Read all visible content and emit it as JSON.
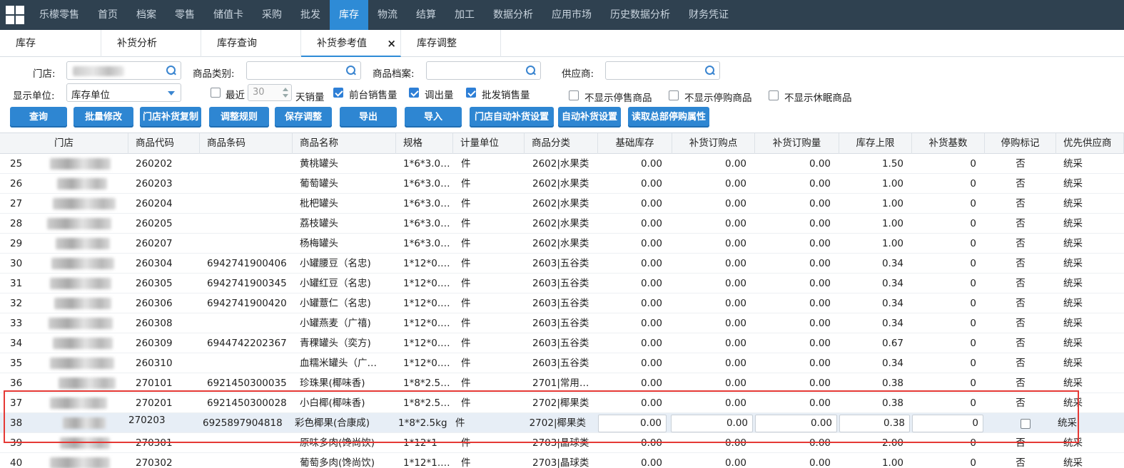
{
  "nav": {
    "items": [
      "乐檬零售",
      "首页",
      "档案",
      "零售",
      "储值卡",
      "采购",
      "批发",
      "库存",
      "物流",
      "结算",
      "加工",
      "数据分析",
      "应用市场",
      "历史数据分析",
      "财务凭证"
    ],
    "active_index": 7
  },
  "tabs": {
    "items": [
      "库存",
      "补货分析",
      "库存查询",
      "补货参考值",
      "库存调整"
    ],
    "active_index": 3,
    "close_glyph": "×"
  },
  "filters": {
    "store_label": "门店:",
    "category_label": "商品类别:",
    "archive_label": "商品档案:",
    "supplier_label": "供应商:",
    "unit_label": "显示单位:",
    "unit_value": "库存单位",
    "recent_label": "最近",
    "recent_days": "30",
    "days_label": "天销量",
    "checkboxes": [
      {
        "label": "前台销售量",
        "checked": true
      },
      {
        "label": "调出量",
        "checked": true
      },
      {
        "label": "批发销售量",
        "checked": true
      },
      {
        "label": "不显示停售商品",
        "checked": false
      },
      {
        "label": "不显示停购商品",
        "checked": false
      },
      {
        "label": "不显示休眠商品",
        "checked": false
      }
    ]
  },
  "buttons": [
    "查询",
    "批量修改",
    "门店补货复制",
    "调整规则",
    "保存调整",
    "导出",
    "导入",
    "门店自动补货设置",
    "自动补货设置",
    "读取总部停购属性"
  ],
  "table": {
    "headers": [
      "门店",
      "商品代码",
      "商品条码",
      "商品名称",
      "规格",
      "计量单位",
      "商品分类",
      "基础库存",
      "补货订购点",
      "补货订购量",
      "库存上限",
      "补货基数",
      "停购标记",
      "优先供应商"
    ],
    "rows": [
      {
        "no": "25",
        "code": "260202",
        "barcode": "",
        "name": "黄桃罐头",
        "spec": "1*6*3.0…",
        "unit": "件",
        "cat": "2602|水果类",
        "base": "0.00",
        "point": "0.00",
        "qty": "0.00",
        "upper": "1.50",
        "basis": "0",
        "stop": "否",
        "supplier": "统采"
      },
      {
        "no": "26",
        "code": "260203",
        "barcode": "",
        "name": "葡萄罐头",
        "spec": "1*6*3.0…",
        "unit": "件",
        "cat": "2602|水果类",
        "base": "0.00",
        "point": "0.00",
        "qty": "0.00",
        "upper": "1.00",
        "basis": "0",
        "stop": "否",
        "supplier": "统采"
      },
      {
        "no": "27",
        "code": "260204",
        "barcode": "",
        "name": "枇杷罐头",
        "spec": "1*6*3.0…",
        "unit": "件",
        "cat": "2602|水果类",
        "base": "0.00",
        "point": "0.00",
        "qty": "0.00",
        "upper": "1.00",
        "basis": "0",
        "stop": "否",
        "supplier": "统采"
      },
      {
        "no": "28",
        "code": "260205",
        "barcode": "",
        "name": "荔枝罐头",
        "spec": "1*6*3.0…",
        "unit": "件",
        "cat": "2602|水果类",
        "base": "0.00",
        "point": "0.00",
        "qty": "0.00",
        "upper": "1.00",
        "basis": "0",
        "stop": "否",
        "supplier": "统采"
      },
      {
        "no": "29",
        "code": "260207",
        "barcode": "",
        "name": "杨梅罐头",
        "spec": "1*6*3.0…",
        "unit": "件",
        "cat": "2602|水果类",
        "base": "0.00",
        "point": "0.00",
        "qty": "0.00",
        "upper": "1.00",
        "basis": "0",
        "stop": "否",
        "supplier": "统采"
      },
      {
        "no": "30",
        "code": "260304",
        "barcode": "6942741900406",
        "name": "小罐腰豆（名忠)",
        "spec": "1*12*0.…",
        "unit": "件",
        "cat": "2603|五谷类",
        "base": "0.00",
        "point": "0.00",
        "qty": "0.00",
        "upper": "0.34",
        "basis": "0",
        "stop": "否",
        "supplier": "统采"
      },
      {
        "no": "31",
        "code": "260305",
        "barcode": "6942741900345",
        "name": "小罐红豆（名忠)",
        "spec": "1*12*0.…",
        "unit": "件",
        "cat": "2603|五谷类",
        "base": "0.00",
        "point": "0.00",
        "qty": "0.00",
        "upper": "0.34",
        "basis": "0",
        "stop": "否",
        "supplier": "统采"
      },
      {
        "no": "32",
        "code": "260306",
        "barcode": "6942741900420",
        "name": "小罐薏仁（名忠)",
        "spec": "1*12*0.…",
        "unit": "件",
        "cat": "2603|五谷类",
        "base": "0.00",
        "point": "0.00",
        "qty": "0.00",
        "upper": "0.34",
        "basis": "0",
        "stop": "否",
        "supplier": "统采"
      },
      {
        "no": "33",
        "code": "260308",
        "barcode": "",
        "name": "小罐燕麦（广禧)",
        "spec": "1*12*0.…",
        "unit": "件",
        "cat": "2603|五谷类",
        "base": "0.00",
        "point": "0.00",
        "qty": "0.00",
        "upper": "0.34",
        "basis": "0",
        "stop": "否",
        "supplier": "统采"
      },
      {
        "no": "34",
        "code": "260309",
        "barcode": "6944742202367",
        "name": "青稞罐头（奕方)",
        "spec": "1*12*0.…",
        "unit": "件",
        "cat": "2603|五谷类",
        "base": "0.00",
        "point": "0.00",
        "qty": "0.00",
        "upper": "0.67",
        "basis": "0",
        "stop": "否",
        "supplier": "统采"
      },
      {
        "no": "35",
        "code": "260310",
        "barcode": "",
        "name": "血糯米罐头（广…",
        "spec": "1*12*0.…",
        "unit": "件",
        "cat": "2603|五谷类",
        "base": "0.00",
        "point": "0.00",
        "qty": "0.00",
        "upper": "0.34",
        "basis": "0",
        "stop": "否",
        "supplier": "统采"
      },
      {
        "no": "36",
        "code": "270101",
        "barcode": "6921450300035",
        "name": "珍珠果(椰味香)",
        "spec": "1*8*2.5…",
        "unit": "件",
        "cat": "2701|常用…",
        "base": "0.00",
        "point": "0.00",
        "qty": "0.00",
        "upper": "0.38",
        "basis": "0",
        "stop": "否",
        "supplier": "统采"
      },
      {
        "no": "37",
        "code": "270201",
        "barcode": "6921450300028",
        "name": "小白椰(椰味香)",
        "spec": "1*8*2.5…",
        "unit": "件",
        "cat": "2702|椰果类",
        "base": "0.00",
        "point": "0.00",
        "qty": "0.00",
        "upper": "0.38",
        "basis": "0",
        "stop": "否",
        "supplier": "统采"
      },
      {
        "no": "38",
        "code": "270203",
        "barcode": "6925897904818",
        "name": "彩色椰果(合康成)",
        "spec": "1*8*2.5kg",
        "unit": "件",
        "cat": "2702|椰果类",
        "base": "0.00",
        "point": "0.00",
        "qty": "0.00",
        "upper": "0.38",
        "basis": "0",
        "stop": "",
        "supplier": "统采",
        "editing": true
      },
      {
        "no": "39",
        "code": "270301",
        "barcode": "",
        "name": "原味多肉(馋尚饮)",
        "spec": "1*12*1",
        "unit": "件",
        "cat": "2703|晶球类",
        "base": "0.00",
        "point": "0.00",
        "qty": "0.00",
        "upper": "2.00",
        "basis": "0",
        "stop": "否",
        "supplier": "统采"
      },
      {
        "no": "40",
        "code": "270302",
        "barcode": "",
        "name": "葡萄多肉(馋尚饮)",
        "spec": "1*12*1.…",
        "unit": "件",
        "cat": "2703|晶球类",
        "base": "0.00",
        "point": "0.00",
        "qty": "0.00",
        "upper": "1.00",
        "basis": "0",
        "stop": "否",
        "supplier": "统采"
      }
    ]
  },
  "colors": {
    "nav_bg": "#2f4150",
    "accent": "#2e86d2",
    "highlight_border": "#e53935"
  }
}
